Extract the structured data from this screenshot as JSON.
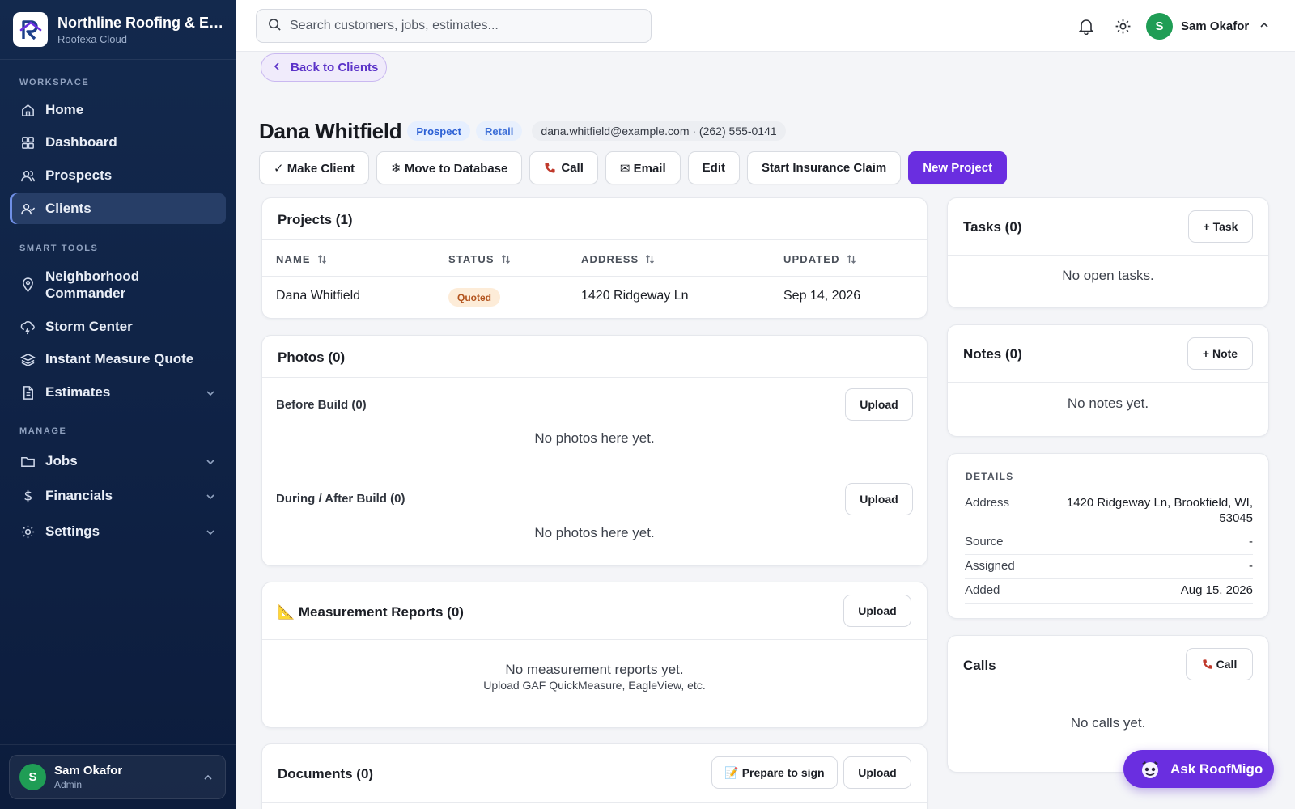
{
  "brand": {
    "name": "Northline Roofing & Ex...",
    "subtitle": "Roofexa Cloud"
  },
  "sidebar": {
    "sections": {
      "workspace": "WORKSPACE",
      "smart_tools": "SMART TOOLS",
      "manage": "MANAGE"
    },
    "items": {
      "home": "Home",
      "dashboard": "Dashboard",
      "prospects": "Prospects",
      "clients": "Clients",
      "neighborhood_line1": "Neighborhood",
      "neighborhood_line2": "Commander",
      "storm": "Storm Center",
      "imq": "Instant Measure Quote",
      "estimates": "Estimates",
      "jobs": "Jobs",
      "financials": "Financials",
      "settings": "Settings"
    },
    "active": "clients",
    "footer": {
      "name": "Sam Okafor",
      "role": "Admin",
      "initial": "S"
    }
  },
  "topbar": {
    "search_placeholder": "Search customers, jobs, estimates...",
    "user": {
      "name": "Sam Okafor",
      "initial": "S"
    }
  },
  "back_label": "Back to Clients",
  "client": {
    "name": "Dana Whitfield",
    "badges": [
      "Prospect",
      "Retail"
    ],
    "contact": "dana.whitfield@example.com · (262) 555-0141"
  },
  "actions": {
    "make_client": "✓ Make Client",
    "move_db": "❄ Move to Database",
    "call": "Call",
    "email": "✉ Email",
    "edit": "Edit",
    "insurance": "Start Insurance Claim",
    "new_project": "New Project"
  },
  "projects": {
    "title": "Projects (1)",
    "columns": [
      "NAME",
      "STATUS",
      "ADDRESS",
      "UPDATED"
    ],
    "rows": [
      {
        "name": "Dana Whitfield",
        "status": "Quoted",
        "address": "1420 Ridgeway Ln",
        "updated": "Sep 14, 2026"
      }
    ]
  },
  "photos": {
    "title": "Photos (0)",
    "before": {
      "label": "Before Build (0)",
      "upload": "Upload",
      "empty": "No photos here yet."
    },
    "during": {
      "label": "During / After Build (0)",
      "upload": "Upload",
      "empty": "No photos here yet."
    }
  },
  "measurements": {
    "title": "📐 Measurement Reports (0)",
    "upload": "Upload",
    "empty": "No measurement reports yet.",
    "empty_sub": "Upload GAF QuickMeasure, EagleView, etc."
  },
  "documents": {
    "title": "Documents (0)",
    "prepare": "📝 Prepare to sign",
    "upload": "Upload"
  },
  "tasks": {
    "title": "Tasks (0)",
    "add": "+ Task",
    "empty": "No open tasks."
  },
  "notes": {
    "title": "Notes (0)",
    "add": "+ Note",
    "empty": "No notes yet."
  },
  "details": {
    "heading": "DETAILS",
    "address_label": "Address",
    "address_line1": "1420 Ridgeway Ln, Brookfield, WI,",
    "address_line2": "53045",
    "source_label": "Source",
    "source_value": "-",
    "assigned_label": "Assigned",
    "assigned_value": "-",
    "added_label": "Added",
    "added_value": "Aug 15, 2026"
  },
  "calls": {
    "title": "Calls",
    "call_btn": "Call",
    "empty": "No calls yet."
  },
  "assistant": {
    "label": "Ask RoofMigo"
  },
  "colors": {
    "accent": "#6a2ee0",
    "sidebar": "#0f2245",
    "avatar": "#1f9d55",
    "quoted_bg": "#fdecd8",
    "quoted_text": "#b3541e"
  }
}
